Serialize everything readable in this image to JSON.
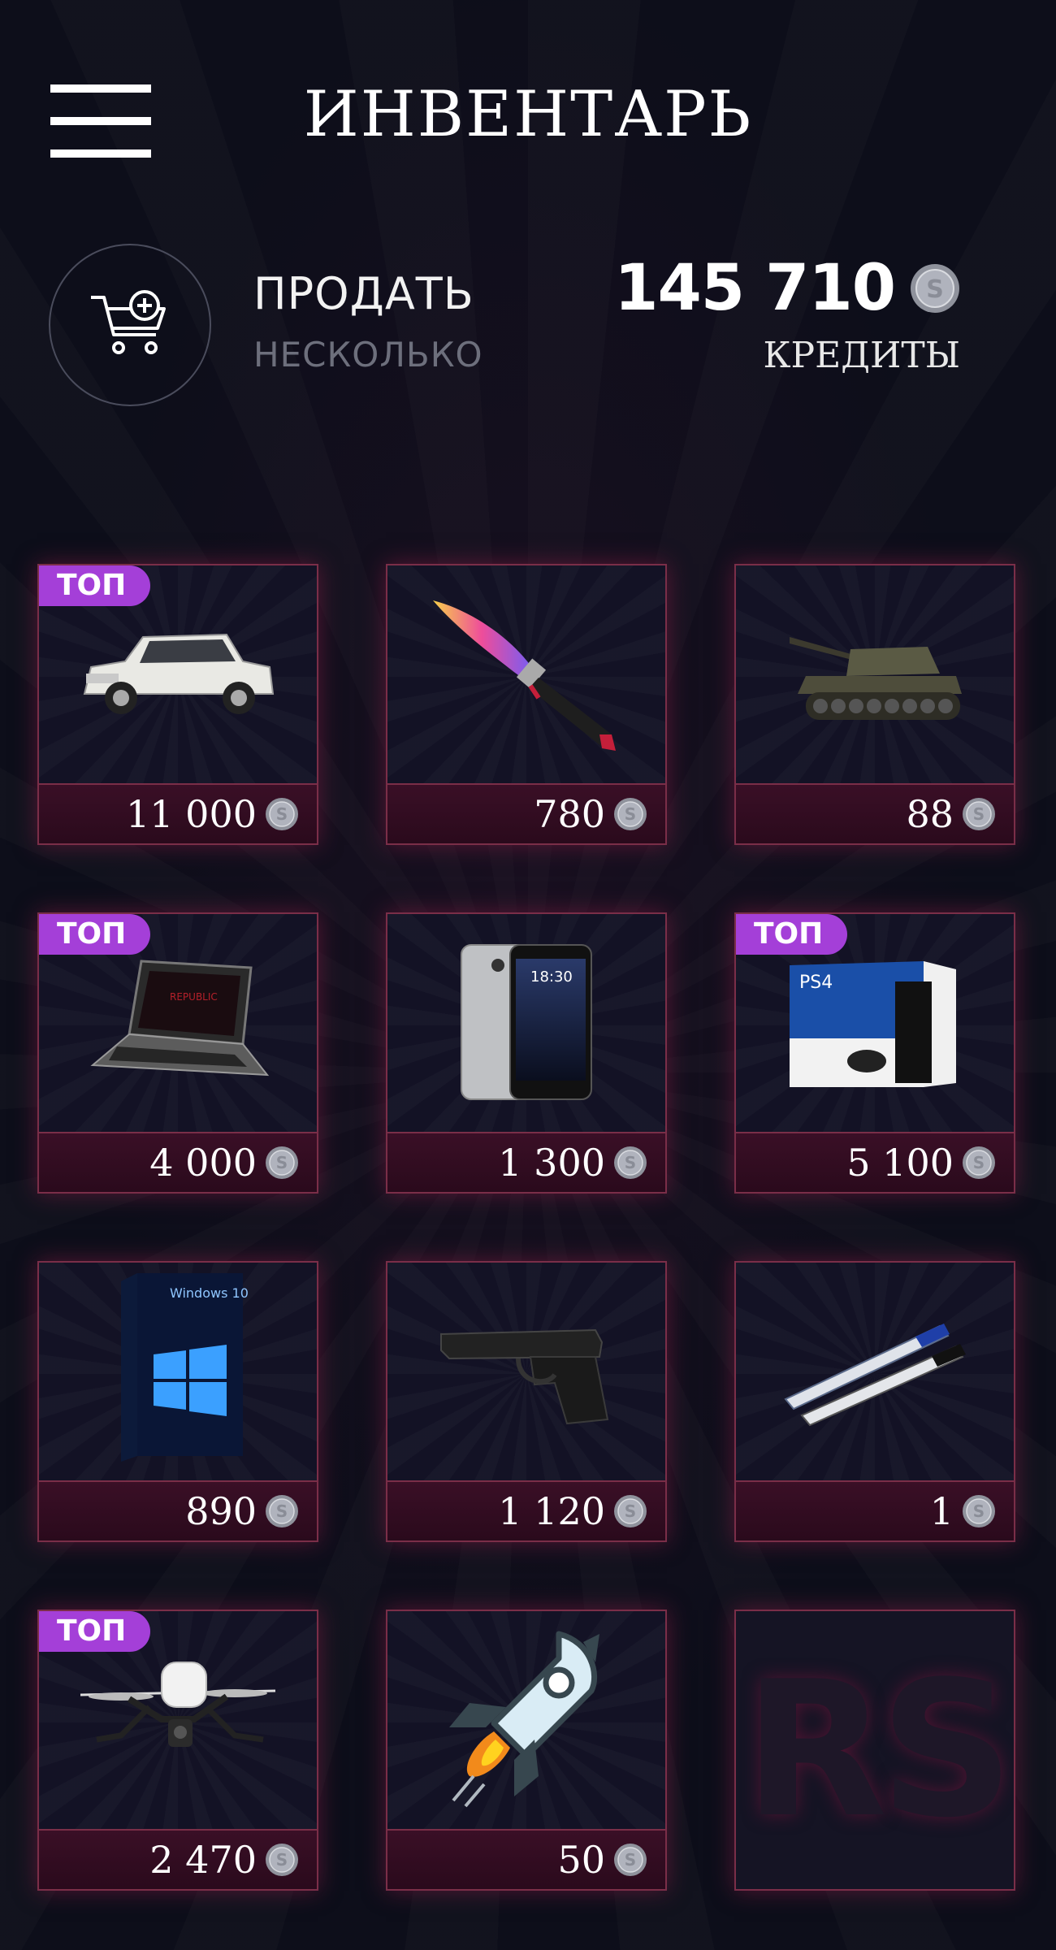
{
  "header": {
    "title": "ИНВЕНТАРЬ"
  },
  "sell": {
    "label": "ПРОДАТЬ",
    "sublabel": "НЕСКОЛЬКО"
  },
  "balance": {
    "value": "145 710",
    "label": "КРЕДИТЫ"
  },
  "badge_label": "ТОП",
  "items": [
    {
      "name": "car",
      "price": "11 000",
      "top": true,
      "icon": "suv-car-icon"
    },
    {
      "name": "knife",
      "price": "780",
      "top": false,
      "icon": "knife-icon"
    },
    {
      "name": "tank",
      "price": "88",
      "top": false,
      "icon": "tank-icon"
    },
    {
      "name": "laptop",
      "price": "4 000",
      "top": true,
      "icon": "laptop-icon"
    },
    {
      "name": "phone",
      "price": "1 300",
      "top": false,
      "icon": "smartphone-icon"
    },
    {
      "name": "console",
      "price": "5 100",
      "top": true,
      "icon": "game-console-box-icon"
    },
    {
      "name": "windows",
      "price": "890",
      "top": false,
      "icon": "windows-box-icon"
    },
    {
      "name": "pistol",
      "price": "1 120",
      "top": false,
      "icon": "pistol-icon"
    },
    {
      "name": "pens",
      "price": "1",
      "top": false,
      "icon": "pens-icon"
    },
    {
      "name": "drone",
      "price": "2 470",
      "top": true,
      "icon": "drone-icon"
    },
    {
      "name": "rocket",
      "price": "50",
      "top": false,
      "icon": "rocket-icon"
    },
    {
      "name": "empty",
      "price": "",
      "top": false,
      "icon": "rs-logo",
      "logo_text": "RS"
    }
  ],
  "colors": {
    "background": "#0d0e1a",
    "card_border": "#7a2e48",
    "price_bar": "#3a0f26",
    "badge": "#a43fd8",
    "coin": "#b0b3bd"
  }
}
